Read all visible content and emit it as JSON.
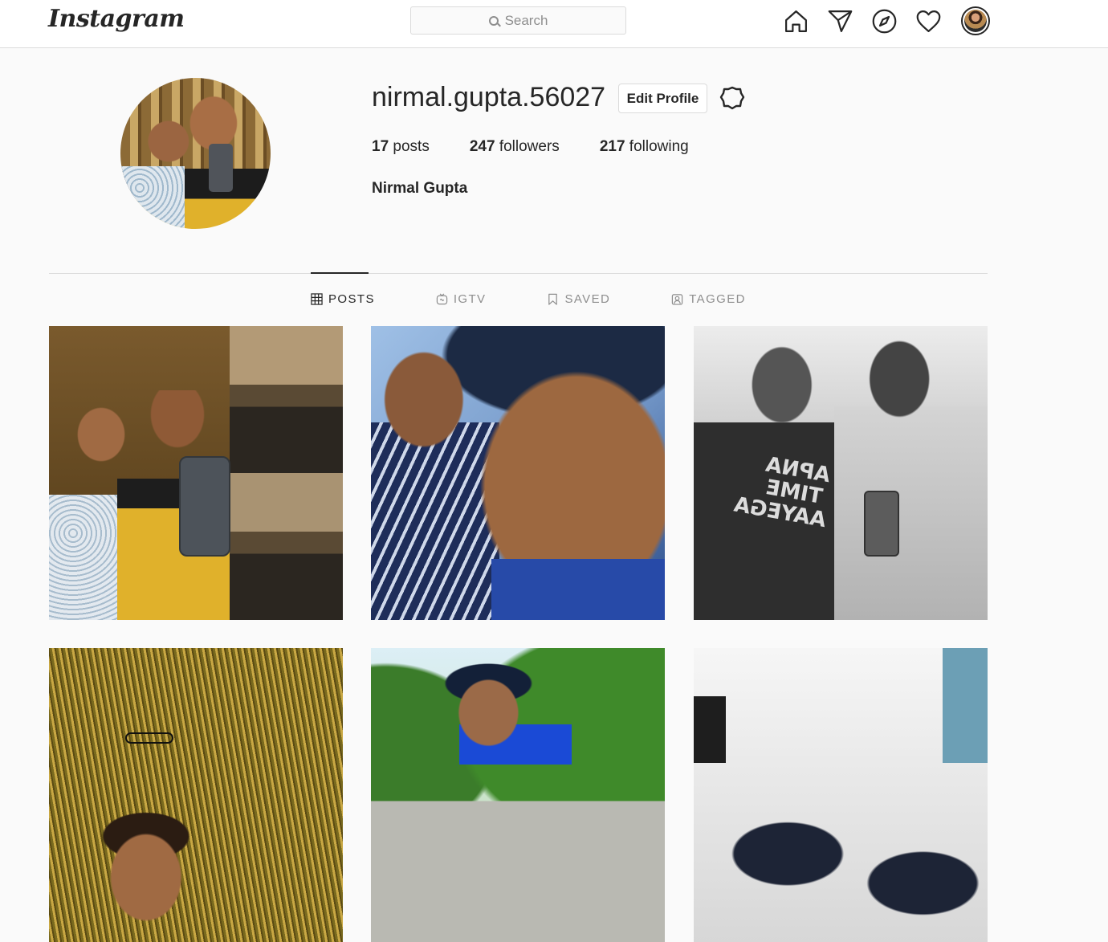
{
  "nav": {
    "logo": "Instagram",
    "search_placeholder": "Search",
    "icons": [
      "home-icon",
      "direct-icon",
      "explore-icon",
      "activity-heart-icon",
      "profile-avatar"
    ]
  },
  "profile": {
    "username": "nirmal.gupta.56027",
    "edit_button": "Edit Profile",
    "settings_icon": "gear-icon",
    "posts_count": "17",
    "posts_label": "posts",
    "followers_count": "247",
    "followers_label": "followers",
    "following_count": "217",
    "following_label": "following",
    "full_name": "Nirmal Gupta"
  },
  "tabs": [
    {
      "label": "POSTS",
      "icon": "grid-icon",
      "active": true
    },
    {
      "label": "IGTV",
      "icon": "igtv-icon",
      "active": false
    },
    {
      "label": "SAVED",
      "icon": "bookmark-icon",
      "active": false
    },
    {
      "label": "TAGGED",
      "icon": "tagged-icon",
      "active": false
    }
  ],
  "posts": [
    {
      "overlay_text": ""
    },
    {
      "overlay_text": ""
    },
    {
      "overlay_text": "APNA TIME AAYEGA"
    },
    {
      "overlay_text": ""
    },
    {
      "overlay_text": ""
    },
    {
      "overlay_text": ""
    }
  ],
  "colors": {
    "background": "#fafafa",
    "border": "#dbdbdb",
    "text": "#262626",
    "muted": "#8e8e8e"
  }
}
